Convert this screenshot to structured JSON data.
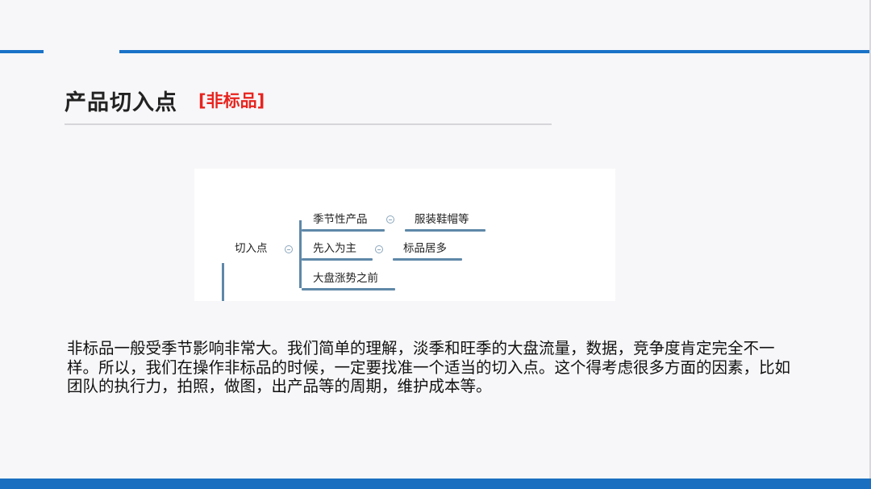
{
  "slide": {
    "title": "产品切入点",
    "tag": "[非标品]"
  },
  "mindmap": {
    "root": "切入点",
    "branches": [
      {
        "label": "季节性产品",
        "child": "服装鞋帽等"
      },
      {
        "label": "先入为主",
        "child": "标品居多"
      },
      {
        "label": "大盘涨势之前"
      }
    ]
  },
  "body": {
    "paragraph": "非标品一般受季节影响非常大。我们简单的理解，淡季和旺季的大盘流量，数据，竞争度肯定完全不一样。所以，我们在操作非标品的时候，一定要找准一个适当的切入点。这个得考虑很多方面的因素，比如团队的执行力，拍照，做图，出产品等的周期，维护成本等。"
  },
  "colors": {
    "accent": "#1a73c8",
    "tag": "#e8231e",
    "mindmap_line": "#5f88a8"
  }
}
